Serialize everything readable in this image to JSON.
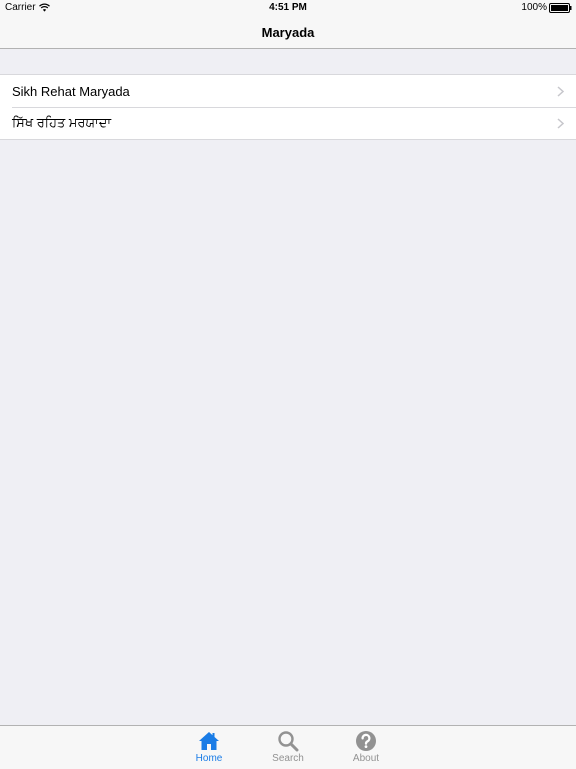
{
  "status_bar": {
    "carrier": "Carrier",
    "time": "4:51 PM",
    "battery": "100%"
  },
  "nav": {
    "title": "Maryada"
  },
  "list": {
    "items": [
      {
        "label": "Sikh Rehat Maryada"
      },
      {
        "label": "ਸਿੱਖ ਰਹਿਤ ਮਰਯਾਦਾ"
      }
    ]
  },
  "tab_bar": {
    "tabs": [
      {
        "label": "Home",
        "icon": "home-icon",
        "active": true
      },
      {
        "label": "Search",
        "icon": "search-icon",
        "active": false
      },
      {
        "label": "About",
        "icon": "question-circle-icon",
        "active": false
      }
    ]
  },
  "colors": {
    "accent": "#1a7ce6",
    "inactive": "#929292",
    "background": "#efeff4",
    "bar": "#f7f7f7",
    "chevron": "#c7c7cc"
  }
}
